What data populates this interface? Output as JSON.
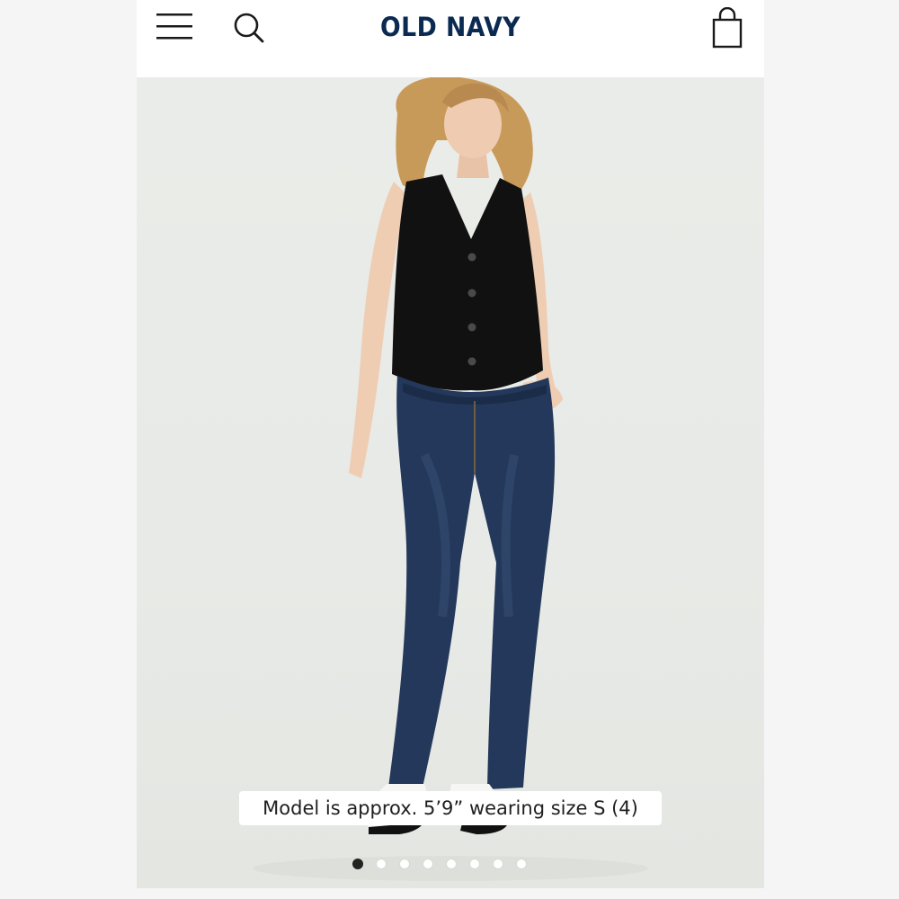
{
  "header": {
    "logo_text": "OLD NAVY",
    "icons": {
      "menu": "hamburger-menu-icon",
      "search": "search-icon",
      "bag": "shopping-bag-icon"
    }
  },
  "product": {
    "image_subject": "model-wearing-black-vest-and-dark-skinny-jeans",
    "caption": "Model is approx. 5’9” wearing size S (4)",
    "carousel": {
      "total": 8,
      "active_index": 0
    }
  },
  "colors": {
    "logo": "#0b2a52",
    "vest": "#111111",
    "denim": "#23385a"
  }
}
